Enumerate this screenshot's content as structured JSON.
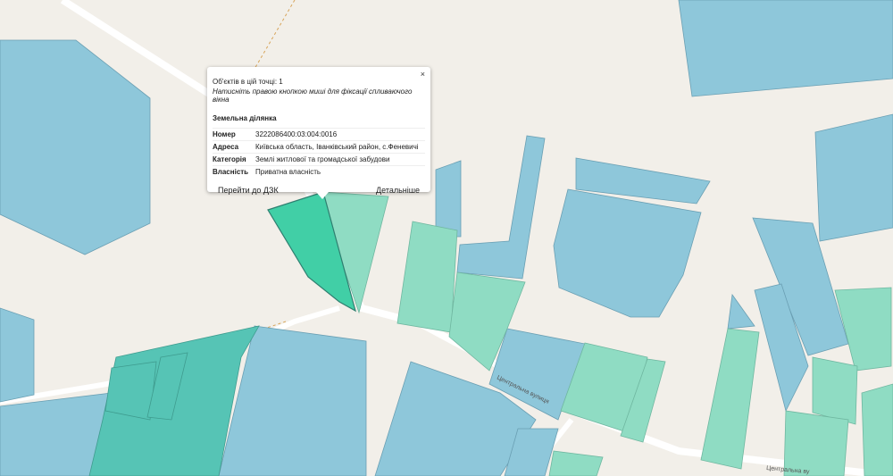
{
  "popup": {
    "count_text": "Об'єктів в цій точці: 1",
    "hint": "Натисніть правою кнопкою миші для фіксації спливаючого вікна",
    "close": "×",
    "section": "Земельна ділянка",
    "rows": [
      {
        "key": "Номер",
        "value": "3222086400:03:004:0016"
      },
      {
        "key": "Адреса",
        "value": "Київська область, Іванківський район, с.Феневичі"
      },
      {
        "key": "Категорія",
        "value": "Землі житлової та громадської забудови"
      },
      {
        "key": "Власність",
        "value": "Приватна власність"
      }
    ],
    "action_dzk": "Перейти до ДЗК",
    "action_details": "Детальніше"
  },
  "streets": {
    "central_1": "Центральна вулиця",
    "central_2": "Центральна ву"
  },
  "colors": {
    "background": "#f2efe9",
    "parcel_blue": "#8ec7da",
    "parcel_mint": "#8fdcc3",
    "parcel_selected": "#41cfa6"
  }
}
